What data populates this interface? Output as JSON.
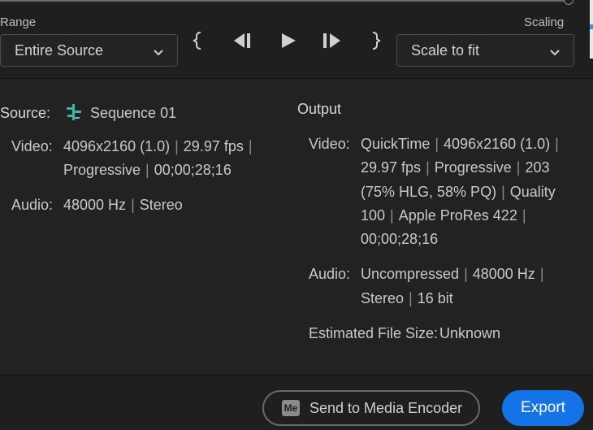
{
  "range": {
    "label": "Range",
    "selected": "Entire Source"
  },
  "scaling": {
    "label": "Scaling",
    "selected": "Scale to fit"
  },
  "source": {
    "heading": "Source:",
    "sequence_name": "Sequence 01",
    "video_label": "Video:",
    "video_line1": [
      "4096x2160 (1.0)",
      "29.97 fps",
      ""
    ],
    "video_line2": [
      "Progressive",
      "00;00;28;16"
    ],
    "audio_label": "Audio:",
    "audio_values": [
      "48000 Hz",
      "Stereo"
    ]
  },
  "output": {
    "heading": "Output",
    "video_label": "Video:",
    "video_lines": [
      [
        "QuickTime",
        "4096x2160 (1.0)",
        ""
      ],
      [
        "29.97 fps",
        "Progressive",
        "203"
      ],
      [
        "(75% HLG, 58% PQ)",
        "Quality"
      ],
      [
        "100",
        "Apple ProRes 422",
        ""
      ],
      [
        "00;00;28;16"
      ]
    ],
    "audio_label": "Audio:",
    "audio_lines": [
      [
        "Uncompressed",
        "48000 Hz",
        ""
      ],
      [
        "Stereo",
        "16 bit"
      ]
    ],
    "file_size_label": "Estimated File Size:",
    "file_size_value": "Unknown"
  },
  "footer": {
    "send_label": "Send to Media Encoder",
    "me_badge": "Me",
    "export_label": "Export"
  },
  "icons": [
    "mark-in-icon",
    "step-back-icon",
    "play-icon",
    "step-forward-icon",
    "mark-out-icon",
    "chevron-down-icon",
    "sequence-icon"
  ],
  "colors": {
    "accent": "#1473e6",
    "sequence_icon": "#3fb7a0"
  }
}
